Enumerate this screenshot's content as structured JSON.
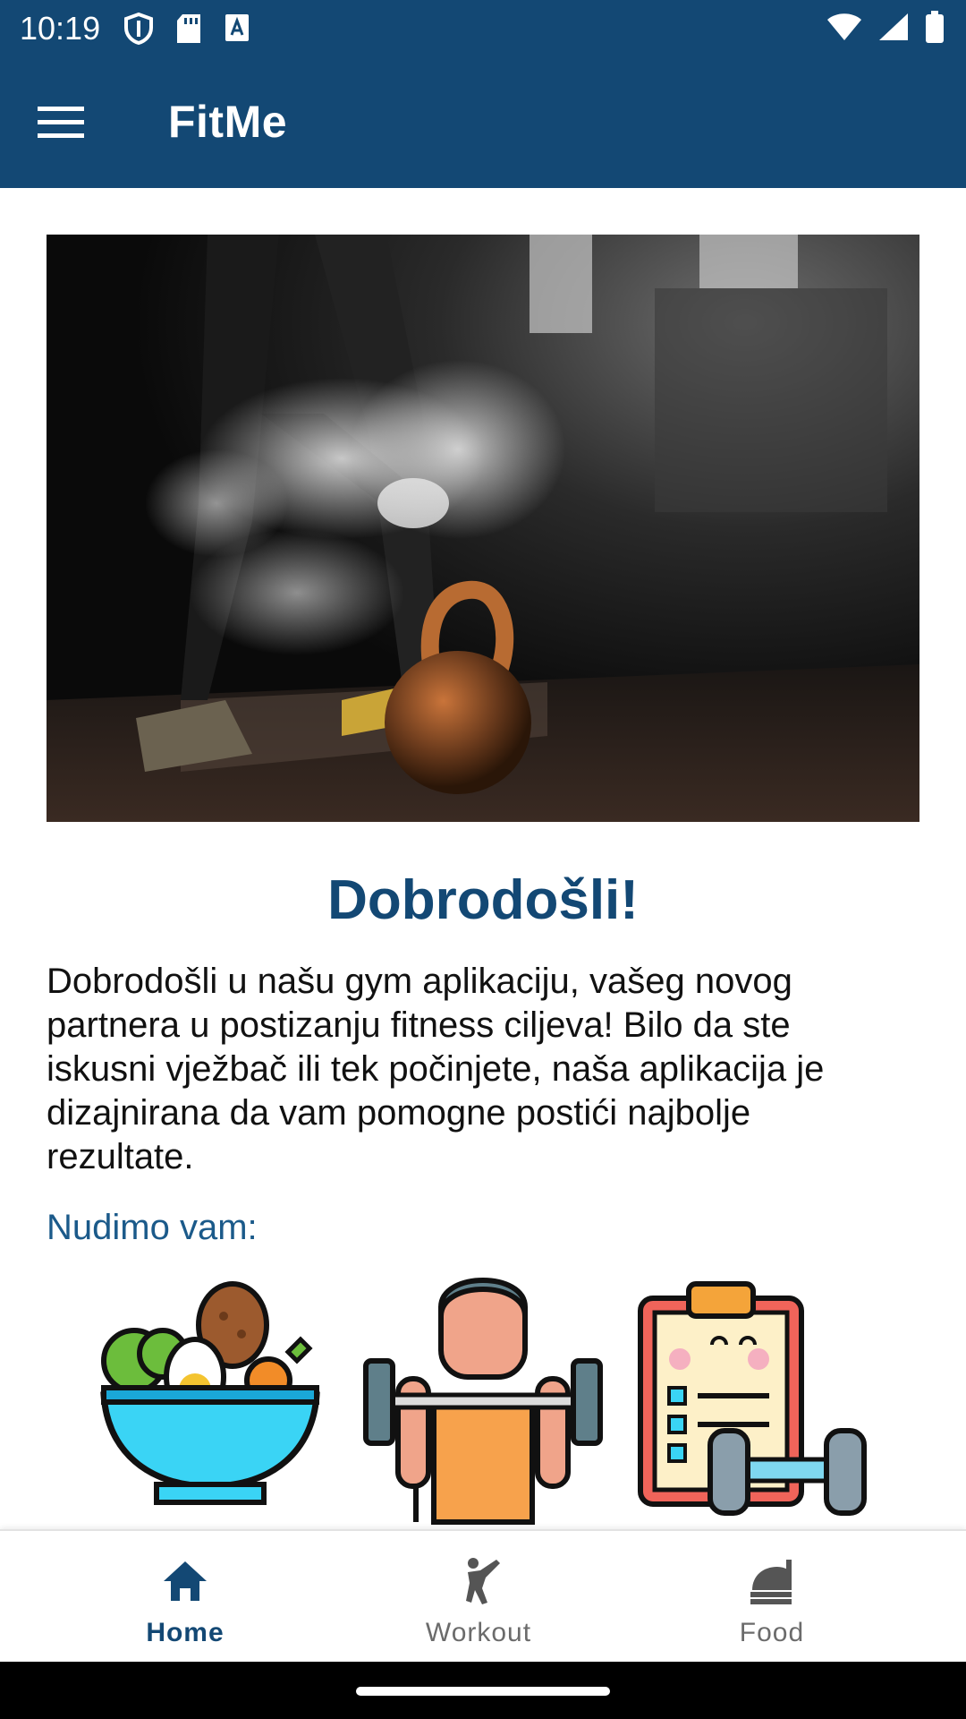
{
  "status_bar": {
    "time": "10:19",
    "icons": [
      "shield-icon",
      "sd-card-icon",
      "font-a-icon",
      "wifi-icon",
      "signal-icon",
      "battery-icon"
    ]
  },
  "app_bar": {
    "title": "FitMe",
    "menu_icon": "hamburger-menu-icon"
  },
  "hero": {
    "image": "kettlebell-chalk-photo"
  },
  "content": {
    "heading": "Dobrodošli!",
    "body": "Dobrodošli u našu gym aplikaciju, vašeg novog partnera u postizanju fitness ciljeva! Bilo da ste iskusni vježbač ili tek počinjete, naša aplikacija je dizajnirana da vam pomogne postići najbolje rezultate.",
    "offer_label": "Nudimo vam:",
    "features": [
      "healthy-food-bowl-icon",
      "weightlifter-icon",
      "workout-plan-clipboard-icon"
    ]
  },
  "bottom_nav": {
    "items": [
      {
        "label": "Home",
        "icon": "home-icon",
        "active": true
      },
      {
        "label": "Workout",
        "icon": "martial-arts-kick-icon",
        "active": false
      },
      {
        "label": "Food",
        "icon": "food-service-icon",
        "active": false
      }
    ]
  },
  "colors": {
    "primary": "#134874",
    "inactive": "#6b6b6b",
    "background": "#ffffff"
  }
}
